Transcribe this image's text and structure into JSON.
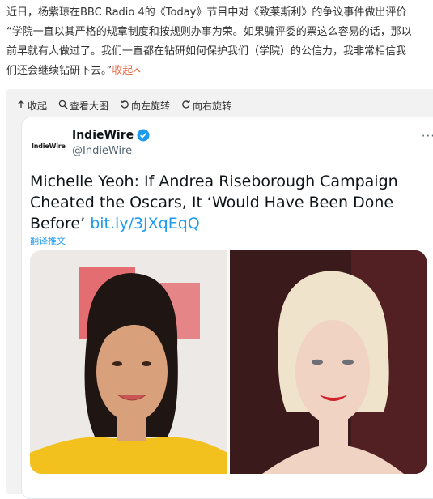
{
  "post": {
    "lines": [
      "近日，杨紫琼在BBC Radio 4的《Today》节目中对《致莱斯利》的争议事件做出评价",
      "“学院一直以其严格的规章制度和按规则办事为荣。如果骗评委的票这么容易的话，那以",
      "前早就有人做过了。我们一直都在钻研如何保护我们（学院）的公信力，我非常相信我",
      "们还会继续钻研下去。”"
    ],
    "collapse_label": "收起"
  },
  "toolbar": {
    "collapse": "收起",
    "view_large": "查看大图",
    "rotate_left": "向左旋转",
    "rotate_right": "向右旋转"
  },
  "tweet": {
    "logo_text": "IndieWire",
    "name": "IndieWire",
    "handle": "@IndieWire",
    "more": "···",
    "body": "Michelle Yeoh: If Andrea Riseborough Campaign Cheated the Oscars, It ‘Would Have Been Done Before’",
    "link": "bit.ly/3JXqEqQ",
    "translate": "翻译推文"
  },
  "colors": {
    "accent_orange": "#eb7350",
    "twitter_blue": "#1d9bf0",
    "verified_blue": "#1d9bf0"
  }
}
